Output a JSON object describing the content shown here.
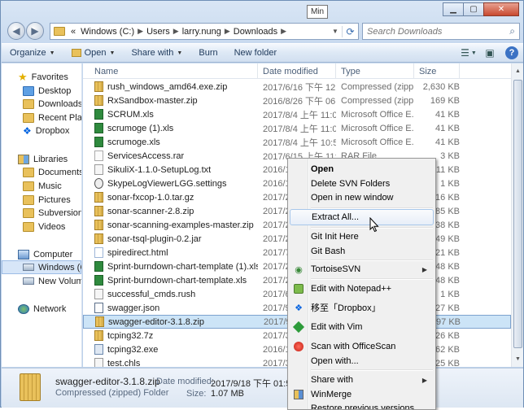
{
  "window": {
    "tooltip": "Min"
  },
  "address": {
    "chevron": "«",
    "crumbs": [
      "Windows (C:)",
      "Users",
      "larry.nung",
      "Downloads"
    ],
    "search_placeholder": "Search Downloads"
  },
  "toolbar": {
    "organize": "Organize",
    "open": "Open",
    "share_with": "Share with",
    "burn": "Burn",
    "new_folder": "New folder"
  },
  "nav": {
    "favorites": "Favorites",
    "desktop": "Desktop",
    "downloads": "Downloads",
    "recent": "Recent Plac",
    "dropbox": "Dropbox",
    "libraries": "Libraries",
    "documents": "Documents",
    "music": "Music",
    "pictures": "Pictures",
    "subversion": "Subversion",
    "videos": "Videos",
    "computer": "Computer",
    "windows_c": "Windows (C",
    "new_volume": "New Volum",
    "network": "Network"
  },
  "columns": {
    "name": "Name",
    "date": "Date modified",
    "type": "Type",
    "size": "Size"
  },
  "files": [
    {
      "name": "rush_windows_amd64.exe.zip",
      "date": "2017/6/16 下午 12:...",
      "type": "Compressed (zipp...",
      "size": "2,630 KB",
      "icon": "zip"
    },
    {
      "name": "RxSandbox-master.zip",
      "date": "2016/8/26 下午 06:...",
      "type": "Compressed (zipp...",
      "size": "169 KB",
      "icon": "zip"
    },
    {
      "name": "SCRUM.xls",
      "date": "2017/8/4 上午 11:02",
      "type": "Microsoft Office E...",
      "size": "41 KB",
      "icon": "xls"
    },
    {
      "name": "scrumoge (1).xls",
      "date": "2017/8/4 上午 11:02",
      "type": "Microsoft Office E...",
      "size": "41 KB",
      "icon": "xls"
    },
    {
      "name": "scrumoge.xls",
      "date": "2017/8/4 上午 10:57",
      "type": "Microsoft Office E...",
      "size": "41 KB",
      "icon": "xls"
    },
    {
      "name": "ServicesAccess.rar",
      "date": "2017/6/15 上午 11:...",
      "type": "RAR File",
      "size": "3 KB",
      "icon": "rar"
    },
    {
      "name": "SikuliX-1.1.0-SetupLog.txt",
      "date": "2016/10",
      "type": "",
      "size": "11 KB",
      "icon": "txt"
    },
    {
      "name": "SkypeLogViewerLGG.settings",
      "date": "2016/12",
      "type": "",
      "size": "1 KB",
      "icon": "gear"
    },
    {
      "name": "sonar-fxcop-1.0.tar.gz",
      "date": "2017/2/",
      "type": "",
      "size": "216 KB",
      "icon": "zip"
    },
    {
      "name": "sonar-scanner-2.8.zip",
      "date": "2017/2/",
      "type": "",
      "size": "485 KB",
      "icon": "zip"
    },
    {
      "name": "sonar-scanning-examples-master.zip",
      "date": "2017/2/",
      "type": "",
      "size": "138 KB",
      "icon": "zip"
    },
    {
      "name": "sonar-tsql-plugin-0.2.jar",
      "date": "2017/2/",
      "type": "",
      "size": "1,549 KB",
      "icon": "zip"
    },
    {
      "name": "spiredirect.html",
      "date": "2017/7/",
      "type": "",
      "size": "21 KB",
      "icon": "htm"
    },
    {
      "name": "Sprint-burndown-chart-template (1).xls",
      "date": "2017/2/",
      "type": "",
      "size": "48 KB",
      "icon": "xls"
    },
    {
      "name": "Sprint-burndown-chart-template.xls",
      "date": "2017/2/",
      "type": "",
      "size": "48 KB",
      "icon": "xls"
    },
    {
      "name": "successful_cmds.rush",
      "date": "2017/6/",
      "type": "",
      "size": "1 KB",
      "icon": "txt"
    },
    {
      "name": "swagger.json",
      "date": "2017/9/",
      "type": "",
      "size": "27 KB",
      "icon": "json"
    },
    {
      "name": "swagger-editor-3.1.8.zip",
      "date": "2017/9/",
      "type": "",
      "size": "1,097 KB",
      "icon": "zip"
    },
    {
      "name": "tcping32.7z",
      "date": "2017/3/",
      "type": "",
      "size": "26 KB",
      "icon": "zip"
    },
    {
      "name": "tcping32.exe",
      "date": "2016/10",
      "type": "",
      "size": "62 KB",
      "icon": "exe"
    },
    {
      "name": "test.chls",
      "date": "2017/3/",
      "type": "",
      "size": "25 KB",
      "icon": "txt"
    }
  ],
  "selected_file_index": 17,
  "context_menu": {
    "items": [
      {
        "label": "Open",
        "bold": true,
        "icon": ""
      },
      {
        "label": "Delete SVN Folders",
        "icon": ""
      },
      {
        "label": "Open in new window",
        "icon": ""
      },
      {
        "label": "Extract All...",
        "icon": "",
        "hover": true
      },
      {
        "label": "Git Init Here",
        "icon": ""
      },
      {
        "label": "Git Bash",
        "icon": ""
      },
      {
        "label": "TortoiseSVN",
        "icon": "tortoisesvn-icon",
        "submenu": true
      },
      {
        "label": "Edit with Notepad++",
        "icon": "notepadpp-icon"
      },
      {
        "label": "移至「Dropbox」",
        "icon": "dropbox-icon"
      },
      {
        "label": "Edit with Vim",
        "icon": "vim-icon"
      },
      {
        "label": "Scan with OfficeScan",
        "icon": "officescan-icon"
      },
      {
        "label": "Open with...",
        "icon": ""
      },
      {
        "label": "Share with",
        "icon": "",
        "submenu": true
      },
      {
        "label": "WinMerge",
        "icon": "winmerge-icon"
      },
      {
        "label": "Restore previous versions",
        "icon": ""
      }
    ]
  },
  "details": {
    "name": "swagger-editor-3.1.8.zip",
    "type": "Compressed (zipped) Folder",
    "date_label": "Date modified:",
    "date_value": "2017/9/18 下午 01:59",
    "size_label": "Size:",
    "size_value": "1.07 MB"
  }
}
